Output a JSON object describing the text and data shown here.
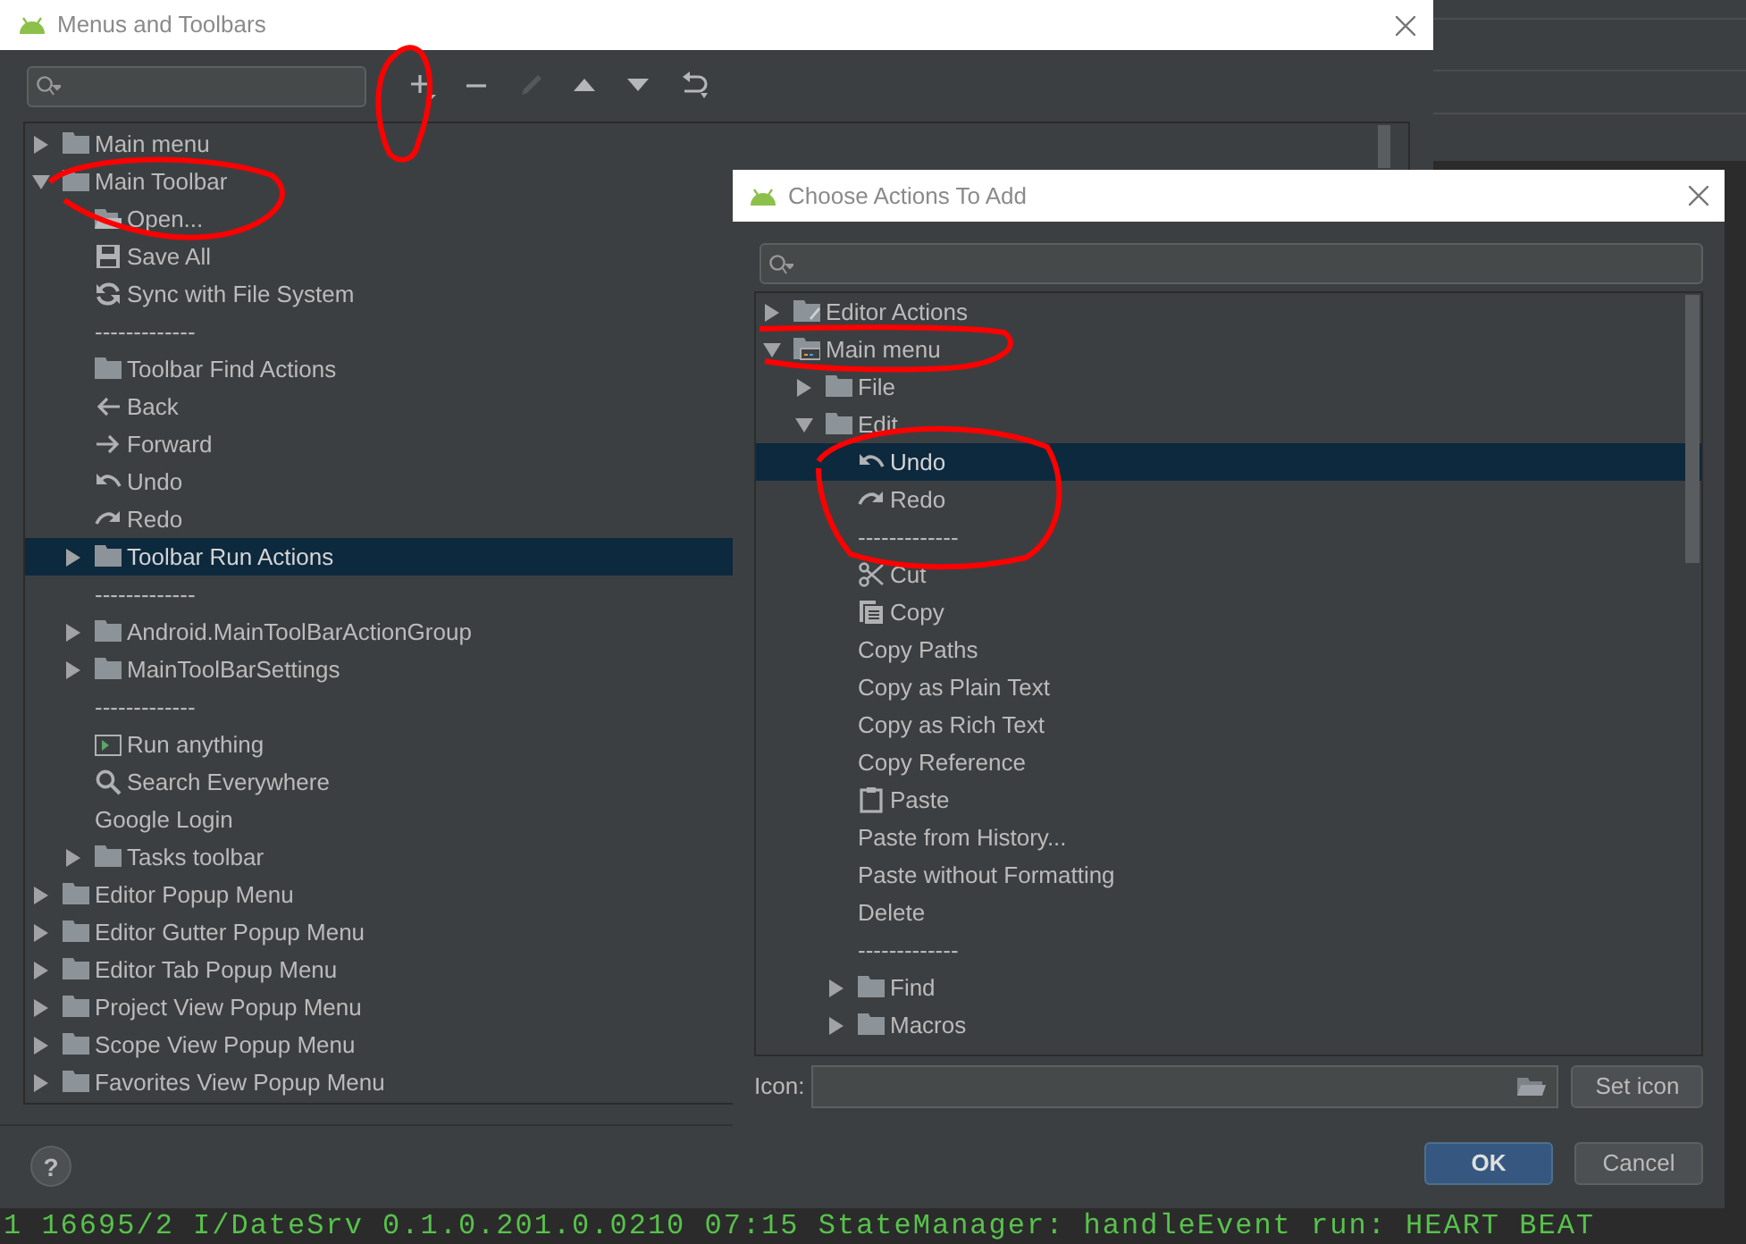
{
  "main_dialog": {
    "title": "Menus and Toolbars",
    "toolbar": [
      {
        "kind": "add",
        "disabled": false
      },
      {
        "kind": "remove",
        "disabled": false
      },
      {
        "kind": "edit",
        "disabled": true
      },
      {
        "kind": "up",
        "disabled": false
      },
      {
        "kind": "down",
        "disabled": false
      },
      {
        "kind": "restore",
        "disabled": false
      }
    ],
    "tree": [
      {
        "label": "Main menu",
        "kind": "folder",
        "expanded": false,
        "selected": false
      },
      {
        "label": "Main Toolbar",
        "kind": "folder",
        "expanded": true,
        "selected": false,
        "children": [
          {
            "label": "Open...",
            "kind": "open",
            "selected": false
          },
          {
            "label": "Save All",
            "kind": "save",
            "selected": false
          },
          {
            "label": "Sync with File System",
            "kind": "sync",
            "selected": false
          },
          {
            "label": "-------------",
            "kind": "separator",
            "selected": false
          },
          {
            "label": "Toolbar Find Actions",
            "kind": "group",
            "selected": false
          },
          {
            "label": "Back",
            "kind": "back",
            "selected": false
          },
          {
            "label": "Forward",
            "kind": "forward",
            "selected": false
          },
          {
            "label": "Undo",
            "kind": "undo",
            "selected": false
          },
          {
            "label": "Redo",
            "kind": "redo",
            "selected": false
          },
          {
            "label": "Toolbar Run Actions",
            "kind": "folder",
            "expanded": false,
            "selected": true
          },
          {
            "label": "-------------",
            "kind": "separator",
            "selected": false
          },
          {
            "label": "Android.MainToolBarActionGroup",
            "kind": "folder",
            "expanded": false,
            "selected": false
          },
          {
            "label": "MainToolBarSettings",
            "kind": "folder",
            "expanded": false,
            "selected": false
          },
          {
            "label": "-------------",
            "kind": "separator",
            "selected": false
          },
          {
            "label": "Run anything",
            "kind": "run",
            "selected": false
          },
          {
            "label": "Search Everywhere",
            "kind": "search",
            "selected": false
          },
          {
            "label": "Google Login",
            "kind": "plain",
            "selected": false
          },
          {
            "label": "Tasks toolbar",
            "kind": "folder",
            "expanded": false,
            "selected": false
          }
        ]
      },
      {
        "label": "Editor Popup Menu",
        "kind": "folder",
        "expanded": false,
        "selected": false
      },
      {
        "label": "Editor Gutter Popup Menu",
        "kind": "folder",
        "expanded": false,
        "selected": false
      },
      {
        "label": "Editor Tab Popup Menu",
        "kind": "folder",
        "expanded": false,
        "selected": false
      },
      {
        "label": "Project View Popup Menu",
        "kind": "folder",
        "expanded": false,
        "selected": false
      },
      {
        "label": "Scope View Popup Menu",
        "kind": "folder",
        "expanded": false,
        "selected": false
      },
      {
        "label": "Favorites View Popup Menu",
        "kind": "folder",
        "expanded": false,
        "selected": false
      }
    ],
    "help_button": "?"
  },
  "add_dialog": {
    "title": "Choose Actions To Add",
    "tree": [
      {
        "label": "Editor Actions",
        "kind": "editor-folder",
        "expanded": false,
        "selected": false
      },
      {
        "label": "Main menu",
        "kind": "menu-folder",
        "expanded": true,
        "selected": false,
        "children": [
          {
            "label": "File",
            "kind": "folder",
            "expanded": false,
            "selected": false
          },
          {
            "label": "Edit",
            "kind": "folder",
            "expanded": true,
            "selected": false,
            "children": [
              {
                "label": "Undo",
                "kind": "undo",
                "selected": true
              },
              {
                "label": "Redo",
                "kind": "redo",
                "selected": false
              },
              {
                "label": "-------------",
                "kind": "separator",
                "selected": false
              },
              {
                "label": "Cut",
                "kind": "cut",
                "selected": false
              },
              {
                "label": "Copy",
                "kind": "copy",
                "selected": false
              },
              {
                "label": "Copy Paths",
                "kind": "plain",
                "selected": false
              },
              {
                "label": "Copy as Plain Text",
                "kind": "plain",
                "selected": false
              },
              {
                "label": "Copy as Rich Text",
                "kind": "plain",
                "selected": false
              },
              {
                "label": "Copy Reference",
                "kind": "plain",
                "selected": false
              },
              {
                "label": "Paste",
                "kind": "paste",
                "selected": false
              },
              {
                "label": "Paste from History...",
                "kind": "plain",
                "selected": false
              },
              {
                "label": "Paste without Formatting",
                "kind": "plain",
                "selected": false
              },
              {
                "label": "Delete",
                "kind": "plain",
                "selected": false
              },
              {
                "label": "-------------",
                "kind": "separator",
                "selected": false
              },
              {
                "label": "Find",
                "kind": "folder",
                "expanded": false,
                "selected": false
              },
              {
                "label": "Macros",
                "kind": "folder",
                "expanded": false,
                "selected": false
              }
            ]
          }
        ]
      }
    ],
    "icon_label": "Icon:",
    "set_icon_button": "Set icon",
    "buttons": [
      {
        "label": "OK",
        "kind": "primary"
      },
      {
        "label": "Cancel",
        "kind": "secondary"
      }
    ]
  },
  "console_line": "1 16695/2 I/DateSrv 0.1.0.201.0.0210 07:15 StateManager: handleEvent run: HEART BEAT"
}
